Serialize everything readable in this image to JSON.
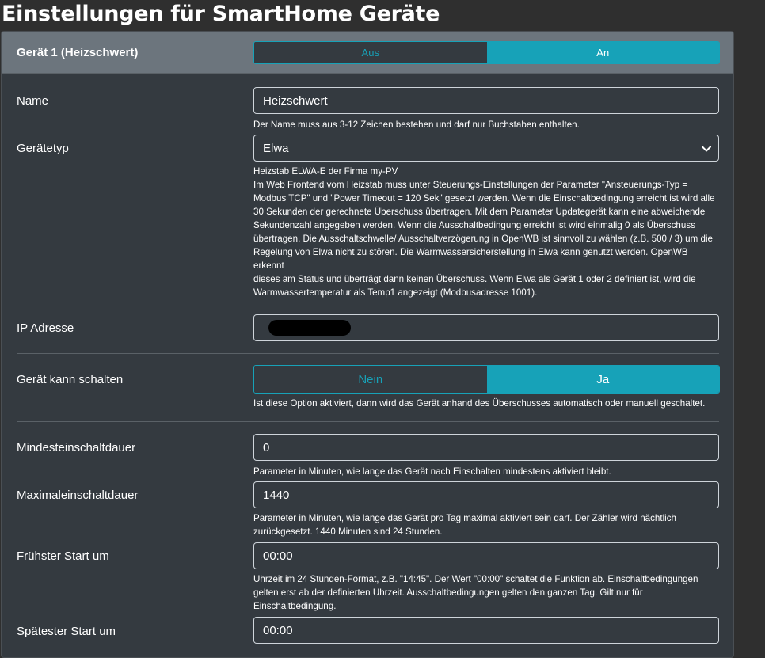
{
  "page": {
    "title": "Einstellungen für SmartHome Geräte"
  },
  "device": {
    "header_title": "Gerät 1 (Heizschwert)",
    "power_toggle": {
      "off_label": "Aus",
      "on_label": "An",
      "selected": "An"
    }
  },
  "fields": {
    "name": {
      "label": "Name",
      "value": "Heizschwert",
      "help": "Der Name muss aus 3-12 Zeichen bestehen und darf nur Buchstaben enthalten."
    },
    "device_type": {
      "label": "Gerätetyp",
      "value": "Elwa",
      "help_lines": [
        "Heizstab ELWA-E der Firma my-PV",
        "Im Web Frontend vom Heizstab muss unter Steuerungs-Einstellungen der Parameter \"Ansteuerungs-Typ =",
        "Modbus TCP\" und \"Power Timeout = 120 Sek\" gesetzt werden. Wenn die Einschaltbedingung erreicht ist wird alle",
        "30 Sekunden der gerechnete Überschuss übertragen. Mit dem Parameter Updategerät kann eine abweichende",
        "Sekundenzahl angegeben werden. Wenn die Ausschaltbedingung erreicht ist wird einmalig 0 als Überschuss",
        "übertragen. Die Ausschaltschwelle/ Ausschaltverzögerung in OpenWB ist sinnvoll zu wählen (z.B. 500 / 3) um die",
        "Regelung von Elwa nicht zu stören. Die Warmwassersicherstellung in Elwa kann genutzt werden. OpenWB erkennt",
        "dieses am Status und überträgt dann keinen Überschuss. Wenn Elwa als Gerät 1 oder 2 definiert ist, wird die",
        "Warmwassertemperatur als Temp1 angezeigt (Modbusadresse 1001)."
      ]
    },
    "ip": {
      "label": "IP Adresse"
    },
    "can_switch": {
      "label": "Gerät kann schalten",
      "no_label": "Nein",
      "yes_label": "Ja",
      "selected": "Ja",
      "help": "Ist diese Option aktiviert, dann wird das Gerät anhand des Überschusses automatisch oder manuell geschaltet."
    },
    "min_on": {
      "label": "Mindesteinschaltdauer",
      "value": "0",
      "help": "Parameter in Minuten, wie lange das Gerät nach Einschalten mindestens aktiviert bleibt."
    },
    "max_on": {
      "label": "Maximaleinschaltdauer",
      "value": "1440",
      "help_lines": [
        "Parameter in Minuten, wie lange das Gerät pro Tag maximal aktiviert sein darf. Der Zähler wird nächtlich",
        "zurückgesetzt. 1440 Minuten sind 24 Stunden."
      ]
    },
    "earliest_start": {
      "label": "Frühster Start um",
      "value": "00:00",
      "help_lines": [
        "Uhrzeit im 24 Stunden-Format, z.B. \"14:45\". Der Wert \"00:00\" schaltet die Funktion ab. Einschaltbedingungen",
        "gelten erst ab der definierten Uhrzeit. Ausschaltbedingungen gelten den ganzen Tag. Gilt nur für",
        "Einschaltbedingung."
      ]
    },
    "latest_start": {
      "label": "Spätester Start um",
      "value": "00:00"
    }
  },
  "icons": {
    "select_arrow": "chevron-down-icon"
  },
  "colors": {
    "accent": "#17a2b8",
    "card": "#343a40",
    "header": "#6c757d",
    "background": "#2f2f2f"
  }
}
